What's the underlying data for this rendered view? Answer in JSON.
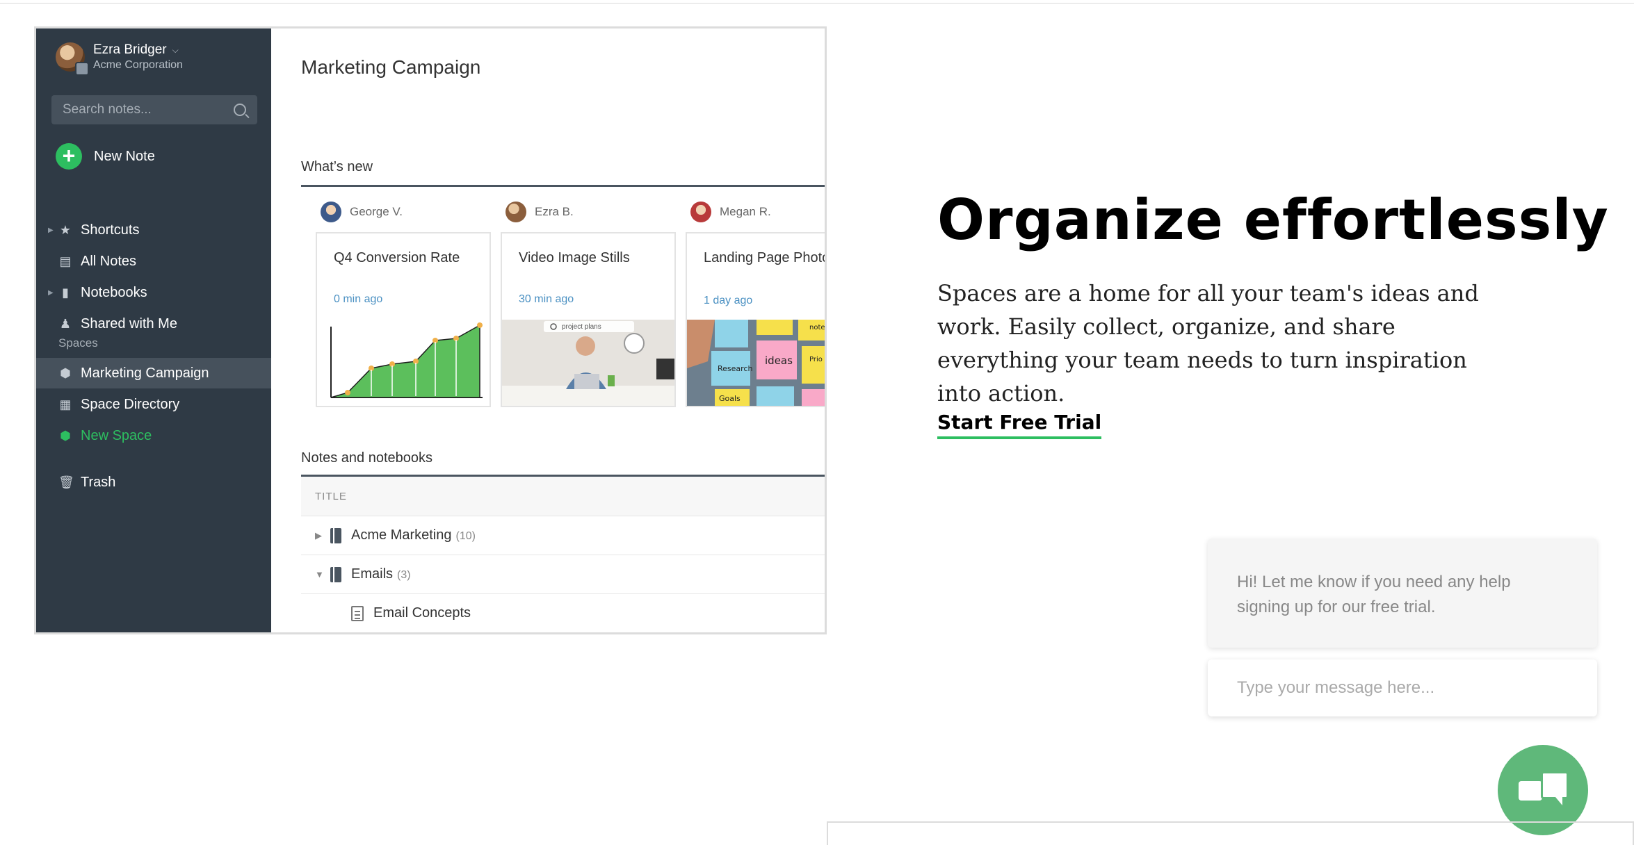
{
  "sidebar": {
    "user_name": "Ezra Bridger",
    "user_org": "Acme Corporation",
    "search_placeholder": "Search notes...",
    "new_note": "New Note",
    "items": [
      "Shortcuts",
      "All Notes",
      "Notebooks",
      "Shared with Me"
    ],
    "spaces_heading": "Spaces",
    "space_items": [
      "Marketing Campaign",
      "Space Directory",
      "New Space"
    ],
    "trash": "Trash"
  },
  "main": {
    "page_title": "Marketing Campaign",
    "whats_new_title": "What’s new",
    "cards": [
      {
        "author": "George V.",
        "title": "Q4 Conversion Rate",
        "time": "0 min ago",
        "media": "line-chart"
      },
      {
        "author": "Ezra B.",
        "title": "Video Image Stills",
        "time": "30 min ago",
        "media": "photo-man-laptop",
        "overlay": "project plans"
      },
      {
        "author": "Megan R.",
        "title": "Landing Page Photos",
        "time": "1 day ago",
        "media": "photo-sticky-notes",
        "stickies": [
          "Research",
          "ideas",
          "Goals",
          "Prio Plan",
          "note"
        ]
      }
    ],
    "notes_title": "Notes and notebooks",
    "table_header": "TITLE",
    "rows": [
      {
        "label": "Acme Marketing",
        "count": "(10)",
        "type": "notebook",
        "expanded": false
      },
      {
        "label": "Emails",
        "count": "(3)",
        "type": "notebook",
        "expanded": true
      },
      {
        "label": "Email Concepts",
        "count": "",
        "type": "note"
      }
    ]
  },
  "marketing": {
    "headline": "Organize effortlessly",
    "body": "Spaces are a home for all your team's ideas and work. Easily collect, organize, and share everything your team needs to turn inspiration into action.",
    "cta": "Start Free Trial"
  },
  "chat": {
    "message": "Hi! Let me know if you need any help signing up for our free trial.",
    "input_placeholder": "Type your message here..."
  },
  "colors": {
    "accent_green": "#2dbe60",
    "sidebar_bg": "#2f3a45",
    "chat_fab": "#5fb87a",
    "link_blue": "#4a90c2"
  }
}
